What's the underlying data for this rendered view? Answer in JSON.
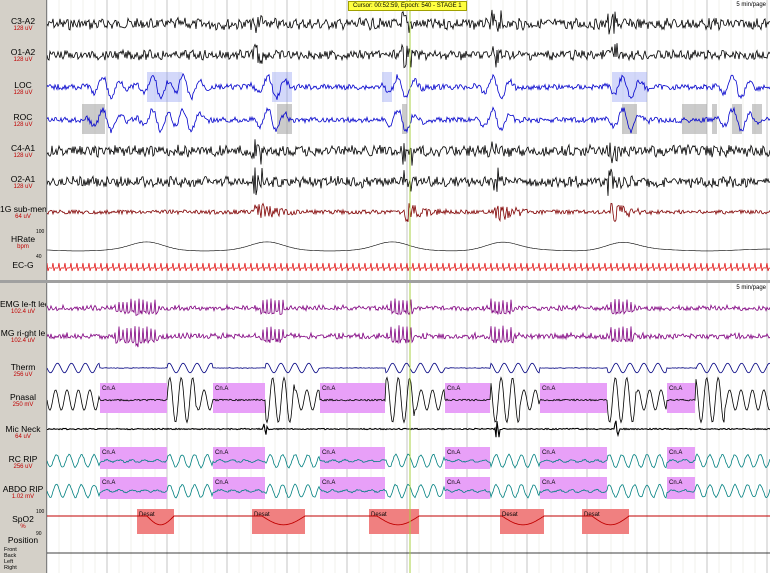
{
  "top_panel": {
    "cursor": "Cursor: 00:52:59, Epoch: 540 - STAGE 1",
    "page_label": "5 min/page",
    "channels": [
      {
        "name": "C3-A2",
        "gain": "128 uV"
      },
      {
        "name": "O1-A2",
        "gain": "128 uV"
      },
      {
        "name": "LOC",
        "gain": "128 uV"
      },
      {
        "name": "ROC",
        "gain": "128 uV"
      },
      {
        "name": "C4-A1",
        "gain": "128 uV"
      },
      {
        "name": "O2-A1",
        "gain": "128 uV"
      },
      {
        "name": "1G sub-men",
        "gain": "64 uV"
      },
      {
        "name": "HRate",
        "gain": "bpm"
      },
      {
        "name": "EC-G",
        "gain": ""
      }
    ],
    "hr_scale": [
      "100",
      "40"
    ]
  },
  "bottom_panel": {
    "page_label": "5 min/page",
    "channels": [
      {
        "name": "EMG le-ft led",
        "gain": "102.4 uV"
      },
      {
        "name": "MG ri-ght le",
        "gain": "102.4 uV"
      },
      {
        "name": "Therm",
        "gain": "256 uV"
      },
      {
        "name": "Pnasal",
        "gain": "250 mV"
      },
      {
        "name": "Mic Neck",
        "gain": "64 uV"
      },
      {
        "name": "RC RIP",
        "gain": "256 uV"
      },
      {
        "name": "ABDO RIP",
        "gain": "1.02 mV"
      },
      {
        "name": "SpO2",
        "gain": "%"
      },
      {
        "name": "Position",
        "gain": ""
      }
    ],
    "spo2_scale": [
      "100",
      "90"
    ],
    "position_labels": [
      "Front",
      "Back",
      "Left",
      "Right"
    ],
    "event_label_apnea": "Cn.A",
    "event_label_desat": "Desat"
  },
  "colors": {
    "eeg": "#000000",
    "eog": "#0000cc",
    "emg": "#800000",
    "ecg": "#e00000",
    "leg": "#800080",
    "therm": "#000080",
    "resp": "#008080",
    "spo2": "#c00000",
    "event_apnea": "#e8a0f8",
    "event_desat": "#f08080",
    "artifact": "#a0a0a0",
    "grid": "#c8c8c8"
  }
}
